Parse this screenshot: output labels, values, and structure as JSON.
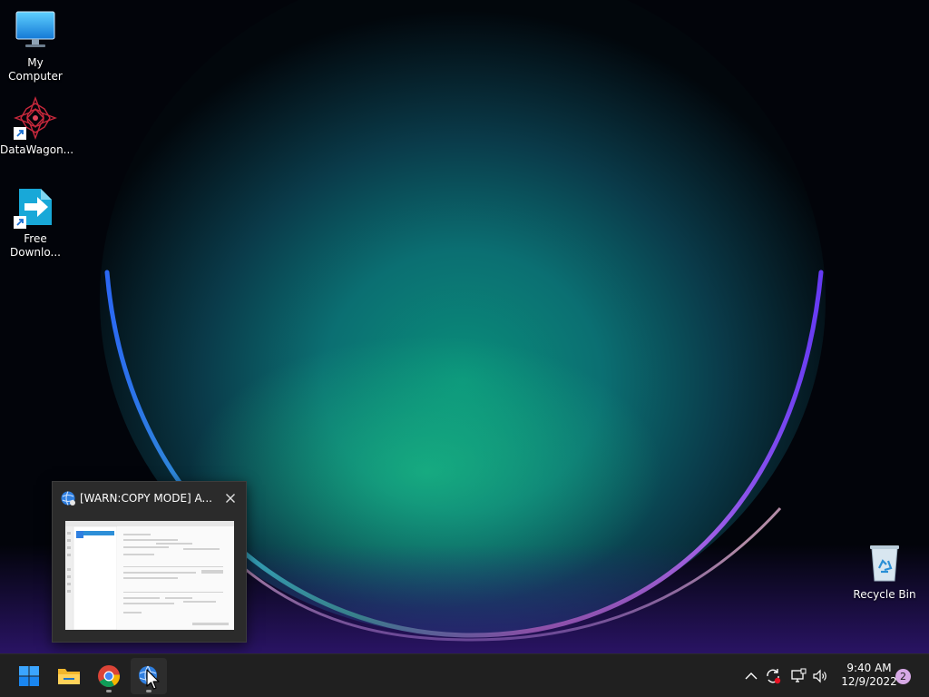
{
  "desktop": {
    "icons": [
      {
        "name": "my-computer",
        "label": "My Computer",
        "icon": "monitor-icon"
      },
      {
        "name": "datawagon",
        "label": "DataWagon...",
        "icon": "datawagon-logo-icon",
        "shortcut": true
      },
      {
        "name": "free-download",
        "label": "Free Downlo...",
        "icon": "download-arrow-icon",
        "shortcut": true
      },
      {
        "name": "recycle-bin",
        "label": "Recycle Bin",
        "icon": "recycle-bin-icon"
      }
    ]
  },
  "preview": {
    "title": "[WARN:COPY MODE] A...",
    "close_icon": "close-icon"
  },
  "taskbar": {
    "items": [
      {
        "name": "start",
        "icon": "windows-start-icon"
      },
      {
        "name": "file-explorer",
        "icon": "folder-icon"
      },
      {
        "name": "chrome",
        "icon": "chrome-icon",
        "running": true
      },
      {
        "name": "app-globe",
        "icon": "globe-app-icon",
        "running": true,
        "active": true
      }
    ],
    "tray": {
      "icons": [
        "chevron-up-icon",
        "sync-icon",
        "network-icon",
        "volume-icon"
      ],
      "time": "9:40 AM",
      "date": "12/9/2022",
      "notification_count": "2"
    }
  },
  "colors": {
    "taskbar_bg": "#202020",
    "accent_blue": "#0a84ff",
    "badge": "#d7a9e6"
  }
}
